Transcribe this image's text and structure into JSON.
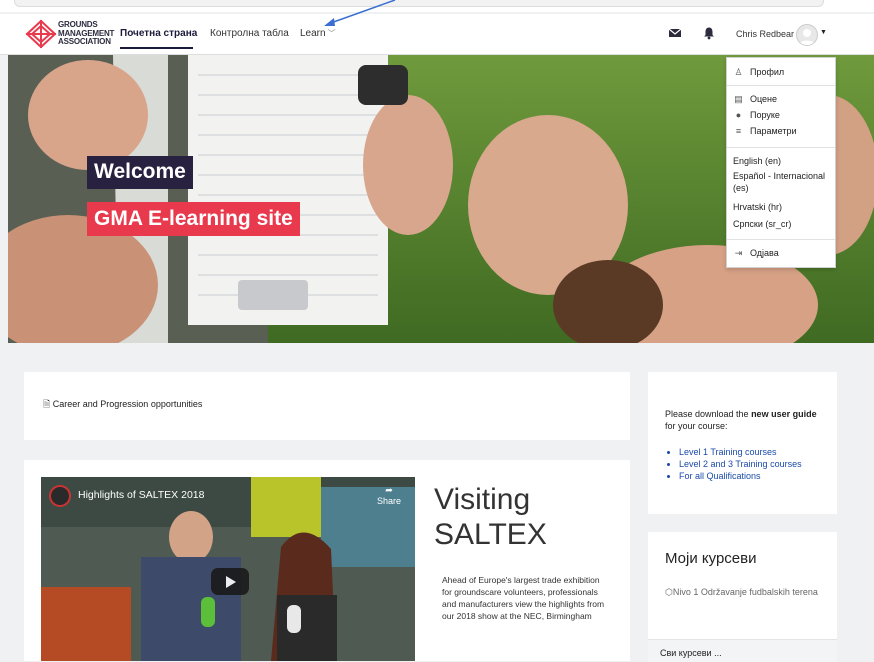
{
  "brand": {
    "logo_lines": [
      "GROUNDS",
      "MANAGEMENT",
      "ASSOCIATION"
    ]
  },
  "nav": {
    "home": "Почетна страна",
    "dashboard": "Контролна табла",
    "learn": "Learn",
    "user_name": "Chris Redbear"
  },
  "icons": {
    "messages": "envelope-icon",
    "notifications": "bell-icon",
    "user_menu": "caret-down-icon"
  },
  "hero": {
    "welcome": "Welcome",
    "site_name": "GMA E-learning site"
  },
  "user_menu": {
    "profile": "Профил",
    "grades": "Оцене",
    "messages": "Поруке",
    "preferences": "Параметри",
    "languages": [
      "English (en)",
      "Español - Internacional (es)",
      "Hrvatski (hr)",
      "Српски (sr_cr)"
    ],
    "logout": "Одјава"
  },
  "career": {
    "link": "Career and Progression opportunities"
  },
  "guide": {
    "prefix": "Please download the ",
    "bold": "new user guide",
    "suffix": " for your course:",
    "links": [
      "Level 1 Training courses",
      "Level 2 and 3 Training courses",
      "For all Qualifications"
    ]
  },
  "video": {
    "title": "Highlights of SALTEX 2018",
    "share": "Share"
  },
  "visiting": {
    "title": "Visiting SALTEX",
    "body": "Ahead of Europe's largest trade exhibition for groundscare volunteers, professionals and manufacturers view the highlights from our 2018 show at the NEC, Birmingham"
  },
  "my_courses": {
    "title": "Моји курсеви",
    "items": [
      "Nivo 1 Održavanje fudbalskih terena"
    ],
    "all": "Сви курсеви ..."
  },
  "colors": {
    "welcome_bg": "#28213f",
    "site_name_bg": "#e8394d",
    "link": "#1b4aa8"
  }
}
